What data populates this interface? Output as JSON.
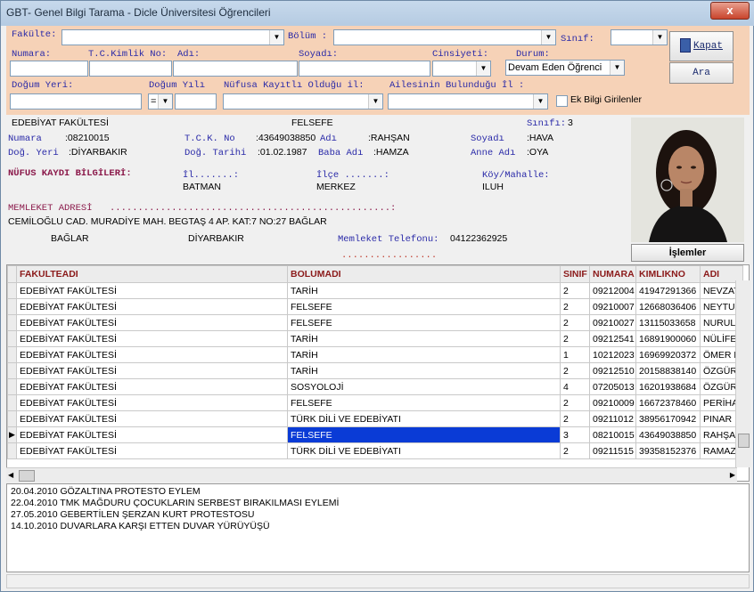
{
  "window": {
    "title": "GBT- Genel Bilgi Tarama - Dicle Üniversitesi Öğrencileri",
    "close": "x"
  },
  "filter": {
    "fakulte_label": "Fakülte:",
    "bolum_label": "Bölüm :",
    "sinif_label": "Sınıf:",
    "numara_label": "Numara:",
    "tc_label": "T.C.Kimlik No:",
    "adi_label": "Adı:",
    "soyadi_label": "Soyadı:",
    "cinsiyet_label": "Cinsiyeti:",
    "durum_label": "Durum:",
    "durum_value": "Devam Eden Öğrenci",
    "dogum_yeri_label": "Doğum Yeri:",
    "dogum_yili_label": "Doğum Yılı",
    "dogum_yili_op": "=",
    "nufus_label": "Nüfusa Kayıtlı Olduğu il:",
    "aile_label": "Ailesinin Bulunduğu İl :",
    "ek_bilgi_label": "Ek Bilgi Girilenler",
    "kapat_label": "Kapat",
    "ara_label": "Ara"
  },
  "student": {
    "fakulte": "EDEBİYAT FAKÜLTESİ",
    "bolum": "FELSEFE",
    "sinif_label": "Sınıfı:",
    "sinif": "3",
    "numara_label": "Numara",
    "numara": ":08210015",
    "tck_label": "T.C.K. No",
    "tck": ":43649038850",
    "adi_label": "Adı",
    "adi": ":RAHŞAN",
    "soyadi_label": "Soyadı",
    "soyadi": ":HAVA",
    "dogyeri_label": "Doğ. Yeri",
    "dogyeri": ":DİYARBAKIR",
    "dogtarihi_label": "Doğ. Tarihi",
    "dogtarihi": ":01.02.1987",
    "baba_label": "Baba Adı",
    "baba": ":HAMZA",
    "anne_label": "Anne Adı",
    "anne": ":OYA",
    "nufus_header": "NÜFUS KAYDI BİLGİLERİ:",
    "il_label": "İl.......:",
    "il": "BATMAN",
    "ilce_label": "İlçe .......:",
    "ilce": "MERKEZ",
    "koy_label": "Köy/Mahalle:",
    "koy": "ILUH",
    "memleket_header": "MEMLEKET ADRESİ",
    "memleket_dots": "..................................................:",
    "adres": "CEMİLOĞLU CAD. MURADİYE MAH. BEGTAŞ 4 AP. KAT:7 NO:27 BAĞLAR",
    "adres_ilce": "BAĞLAR",
    "adres_il": "DİYARBAKIR",
    "telefon_label": "Memleket Telefonu:",
    "telefon": "04122362925",
    "dots2": ".................",
    "islemler": "İşlemler"
  },
  "grid": {
    "columns": [
      "FAKULTEADI",
      "BOLUMADI",
      "SINIF",
      "NUMARA",
      "KIMLIKNO",
      "ADI"
    ],
    "rows": [
      [
        "EDEBİYAT FAKÜLTESİ",
        "TARİH",
        "2",
        "09212004",
        "41947291366",
        "NEVZAT"
      ],
      [
        "EDEBİYAT FAKÜLTESİ",
        "FELSEFE",
        "2",
        "09210007",
        "12668036406",
        "NEYTUL"
      ],
      [
        "EDEBİYAT FAKÜLTESİ",
        "FELSEFE",
        "2",
        "09210027",
        "13115033658",
        "NURULL"
      ],
      [
        "EDEBİYAT FAKÜLTESİ",
        "TARİH",
        "2",
        "09212541",
        "16891900060",
        "NÜLİFEI"
      ],
      [
        "EDEBİYAT FAKÜLTESİ",
        "TARİH",
        "1",
        "10212023",
        "16969920372",
        "ÖMER F"
      ],
      [
        "EDEBİYAT FAKÜLTESİ",
        "TARİH",
        "2",
        "09212510",
        "20158838140",
        "ÖZGÜR"
      ],
      [
        "EDEBİYAT FAKÜLTESİ",
        "SOSYOLOJİ",
        "4",
        "07205013",
        "16201938684",
        "ÖZGÜR"
      ],
      [
        "EDEBİYAT FAKÜLTESİ",
        "FELSEFE",
        "2",
        "09210009",
        "16672378460",
        "PERİHA"
      ],
      [
        "EDEBİYAT FAKÜLTESİ",
        "TÜRK DİLİ VE EDEBİYATI",
        "2",
        "09211012",
        "38956170942",
        "PINAR"
      ],
      [
        "EDEBİYAT FAKÜLTESİ",
        "FELSEFE",
        "3",
        "08210015",
        "43649038850",
        "RAHŞAN"
      ],
      [
        "EDEBİYAT FAKÜLTESİ",
        "TÜRK DİLİ VE EDEBİYATI",
        "2",
        "09211515",
        "39358152376",
        "RAMAZA"
      ]
    ]
  },
  "notes": [
    "20.04.2010 GÖZALTINA PROTESTO EYLEM",
    "22.04.2010 TMK MAĞDURU ÇOCUKLARIN SERBEST BIRAKILMASI EYLEMİ",
    "27.05.2010 GEBERTİLEN ŞERZAN KURT  PROTESTOSU",
    "14.10.2010 DUVARLARA KARŞI ETTEN DUVAR YÜRÜYÜŞÜ"
  ],
  "colors": {
    "filter_bg": "#f6d2b7",
    "selection": "#0a3bd6",
    "label_blue": "#2a2aa8",
    "header_maroon": "#8b1a1a"
  }
}
